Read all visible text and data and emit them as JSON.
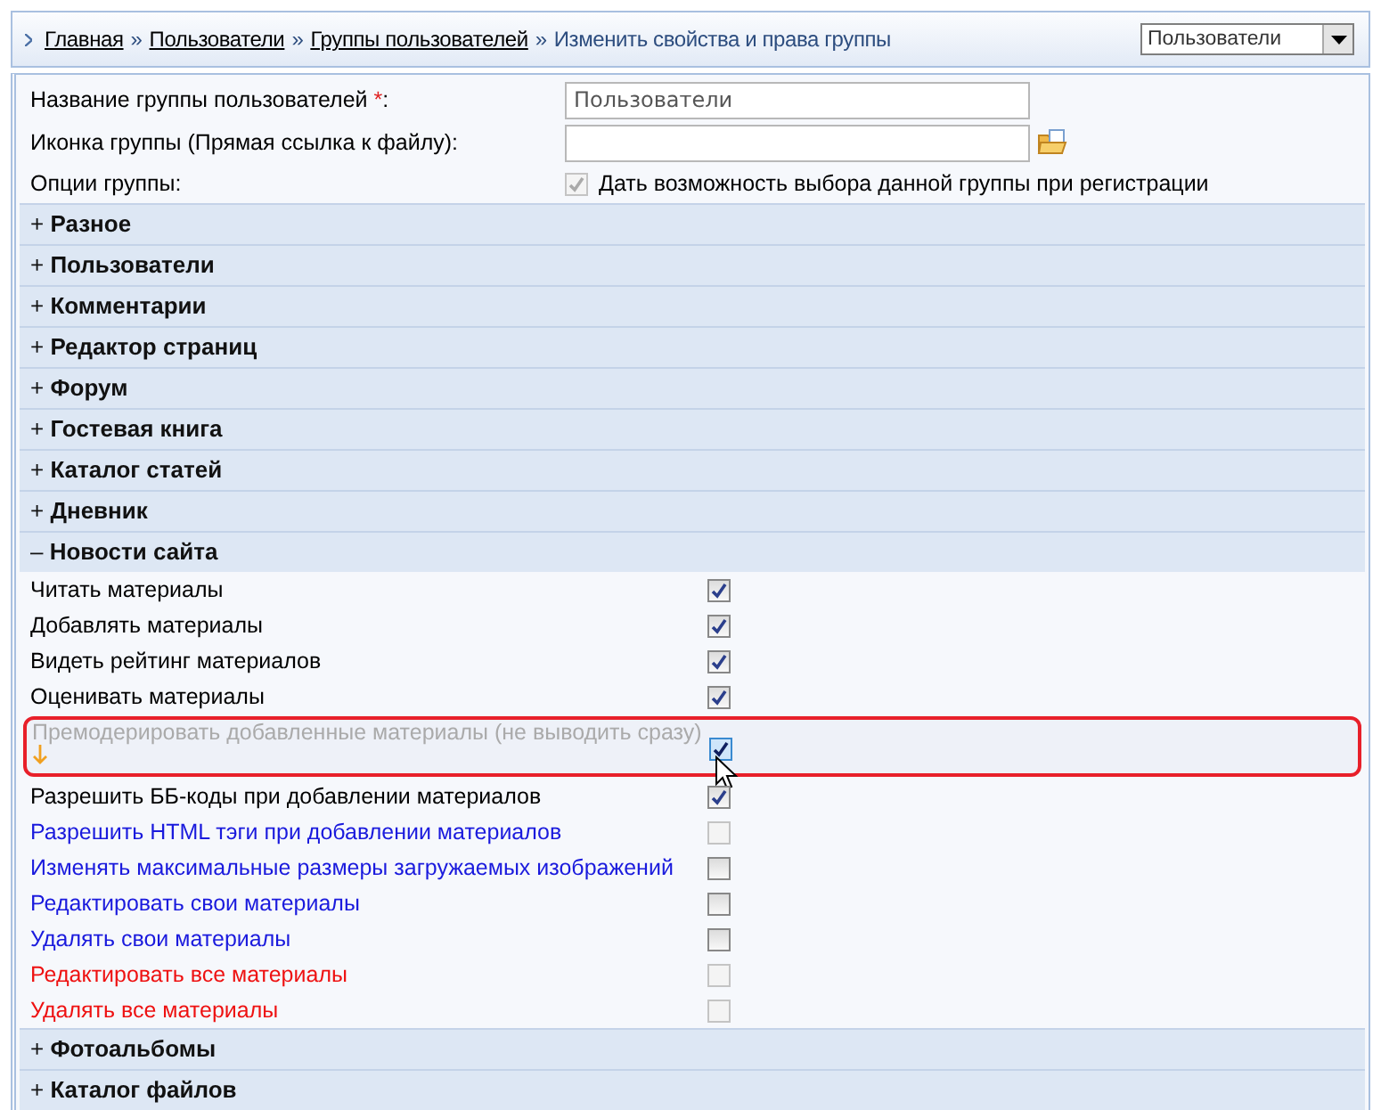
{
  "breadcrumb": {
    "links": [
      "Главная",
      "Пользователи",
      "Группы пользователей"
    ],
    "separator": "»",
    "current": "Изменить свойства и права группы"
  },
  "group_select": {
    "value": "Пользователи"
  },
  "form": {
    "name_label": "Название группы пользователей",
    "required_mark": "*",
    "name_suffix": ":",
    "name_value": "Пользователи",
    "icon_label": "Иконка группы (Прямая ссылка к файлу):",
    "options_label": "Опции группы:",
    "option": {
      "label": "Дать возможность выбора данной группы при регистрации",
      "checked": true,
      "disabled": true
    }
  },
  "sections": [
    {
      "sign": "+",
      "title": "Разное"
    },
    {
      "sign": "+",
      "title": "Пользователи"
    },
    {
      "sign": "+",
      "title": "Комментарии"
    },
    {
      "sign": "+",
      "title": "Редактор страниц"
    },
    {
      "sign": "+",
      "title": "Форум"
    },
    {
      "sign": "+",
      "title": "Гостевая книга"
    },
    {
      "sign": "+",
      "title": "Каталог статей"
    },
    {
      "sign": "+",
      "title": "Дневник"
    },
    {
      "sign": "–",
      "title": "Новости сайта",
      "permissions": [
        {
          "label": "Читать материалы",
          "color": "#000000",
          "checked": true,
          "disabled": false,
          "highlighted": false
        },
        {
          "label": "Добавлять материалы",
          "color": "#000000",
          "checked": true,
          "disabled": false,
          "highlighted": false
        },
        {
          "label": "Видеть рейтинг материалов",
          "color": "#000000",
          "checked": true,
          "disabled": false,
          "highlighted": false
        },
        {
          "label": "Оценивать материалы",
          "color": "#000000",
          "checked": true,
          "disabled": false,
          "highlighted": false
        },
        {
          "label": "Премодерировать добавленные материалы (не выводить сразу)",
          "color": "#aaaaaa",
          "checked": true,
          "disabled": false,
          "highlighted": true
        },
        {
          "label": "Разрешить ББ-коды при добавлении материалов",
          "color": "#000000",
          "checked": true,
          "disabled": false,
          "highlighted": false
        },
        {
          "label": "Разрешить HTML тэги при добавлении материалов",
          "color": "#1a1add",
          "checked": false,
          "disabled": true,
          "highlighted": false
        },
        {
          "label": "Изменять максимальные размеры загружаемых изображений",
          "color": "#1a1add",
          "checked": false,
          "disabled": false,
          "highlighted": false
        },
        {
          "label": "Редактировать свои материалы",
          "color": "#1a1add",
          "checked": false,
          "disabled": false,
          "highlighted": false
        },
        {
          "label": "Удалять свои материалы",
          "color": "#1a1add",
          "checked": false,
          "disabled": false,
          "highlighted": false
        },
        {
          "label": "Редактировать все материалы",
          "color": "#ee1111",
          "checked": false,
          "disabled": true,
          "highlighted": false
        },
        {
          "label": "Удалять все материалы",
          "color": "#ee1111",
          "checked": false,
          "disabled": true,
          "highlighted": false
        }
      ]
    },
    {
      "sign": "+",
      "title": "Фотоальбомы"
    },
    {
      "sign": "+",
      "title": "Каталог файлов"
    }
  ]
}
